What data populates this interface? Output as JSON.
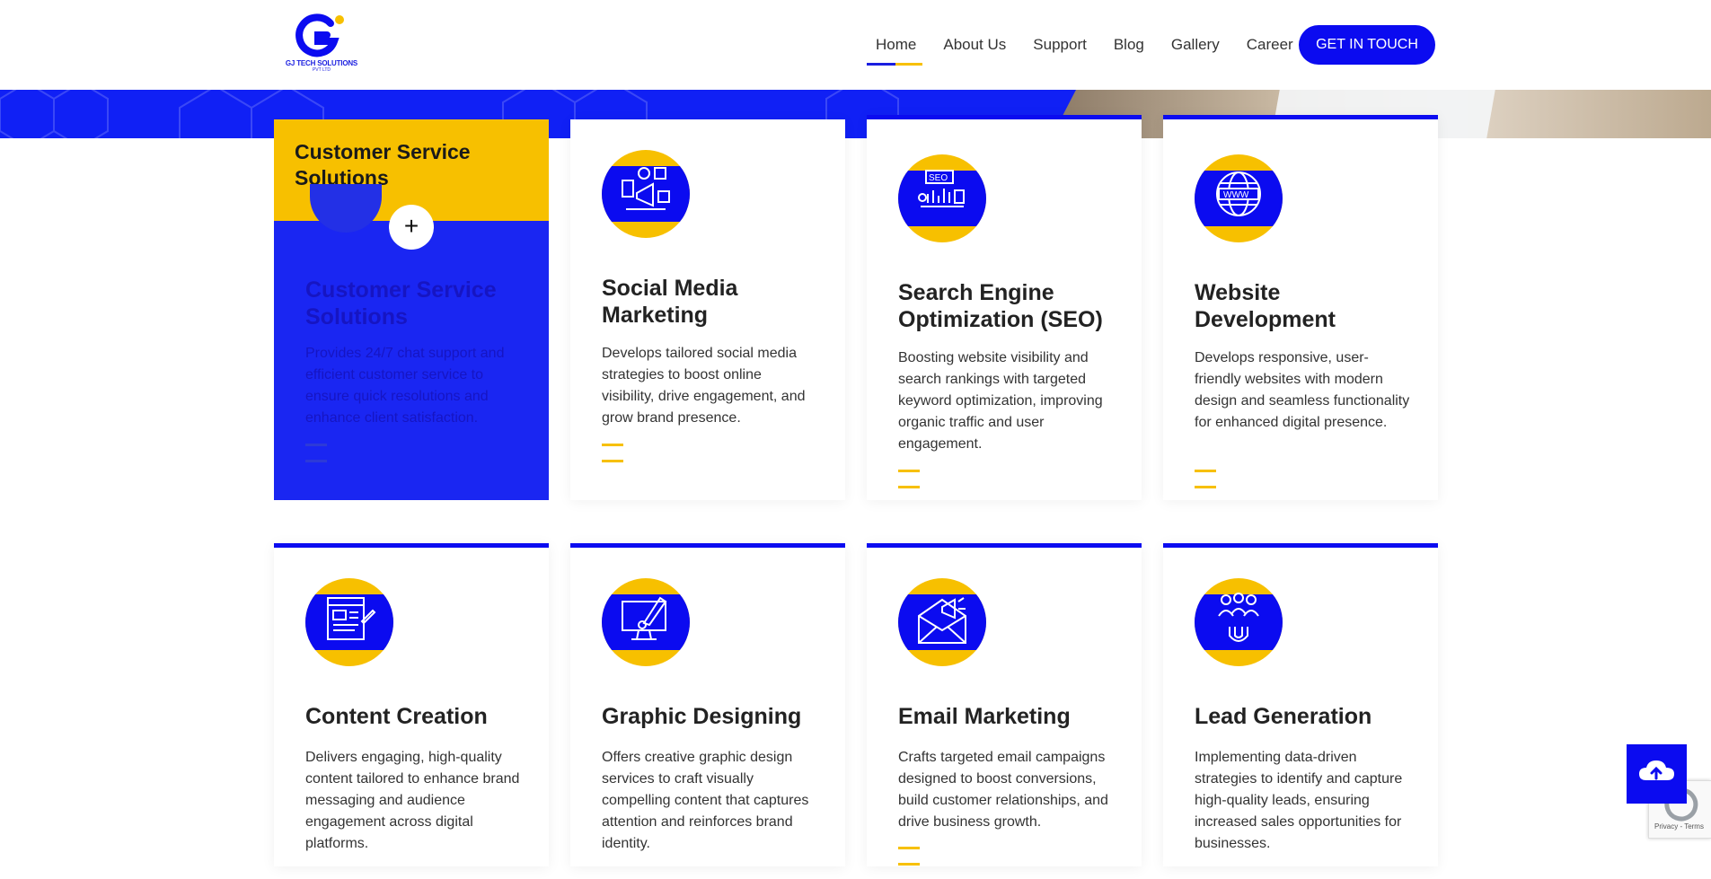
{
  "header": {
    "logo_text": "GJ TECH SOLUTIONS",
    "logo_sub": "PVT LTD",
    "nav": [
      {
        "label": "Home",
        "active": true
      },
      {
        "label": "About Us",
        "active": false
      },
      {
        "label": "Support",
        "active": false
      },
      {
        "label": "Blog",
        "active": false
      },
      {
        "label": "Gallery",
        "active": false
      },
      {
        "label": "Career",
        "active": false
      }
    ],
    "cta_label": "GET IN TOUCH"
  },
  "colors": {
    "brand_blue": "#0b0bf0",
    "accent_yellow": "#f7c000"
  },
  "highlight_card": {
    "head_title": "Customer Service Solutions",
    "title": "Customer Service Solutions",
    "desc": "Provides 24/7 chat support and efficient customer service to ensure quick resolutions and enhance client satisfaction.",
    "plus": "+"
  },
  "cards": [
    {
      "title": "Social Media Marketing",
      "desc": "Develops tailored social media strategies to boost online visibility, drive engagement, and grow brand presence.",
      "icon": "social-media-megaphone-icon"
    },
    {
      "title": "Search Engine Optimization (SEO)",
      "desc": "Boosting website visibility and search rankings with targeted keyword optimization, improving organic traffic and user engagement.",
      "icon": "seo-monitor-icon"
    },
    {
      "title": "Website Development",
      "desc": "Develops responsive, user-friendly websites with modern design and seamless functionality for enhanced digital presence.",
      "icon": "globe-www-icon"
    },
    {
      "title": "Content Creation",
      "desc": "Delivers engaging, high-quality content tailored to enhance brand messaging and audience engagement across digital platforms.",
      "icon": "content-document-pen-icon"
    },
    {
      "title": "Graphic Designing",
      "desc": "Offers creative graphic design services to craft visually compelling content that captures attention and reinforces brand identity.",
      "icon": "design-monitor-brush-icon"
    },
    {
      "title": "Email Marketing",
      "desc": "Crafts targeted email campaigns designed to boost conversions, build customer relationships, and drive business growth.",
      "icon": "email-envelope-megaphone-icon"
    },
    {
      "title": "Lead Generation",
      "desc": "Implementing data-driven strategies to identify and capture high-quality leads, ensuring increased sales opportunities for businesses.",
      "icon": "lead-magnet-people-icon"
    }
  ],
  "recaptcha": {
    "text": "Privacy - Terms"
  }
}
